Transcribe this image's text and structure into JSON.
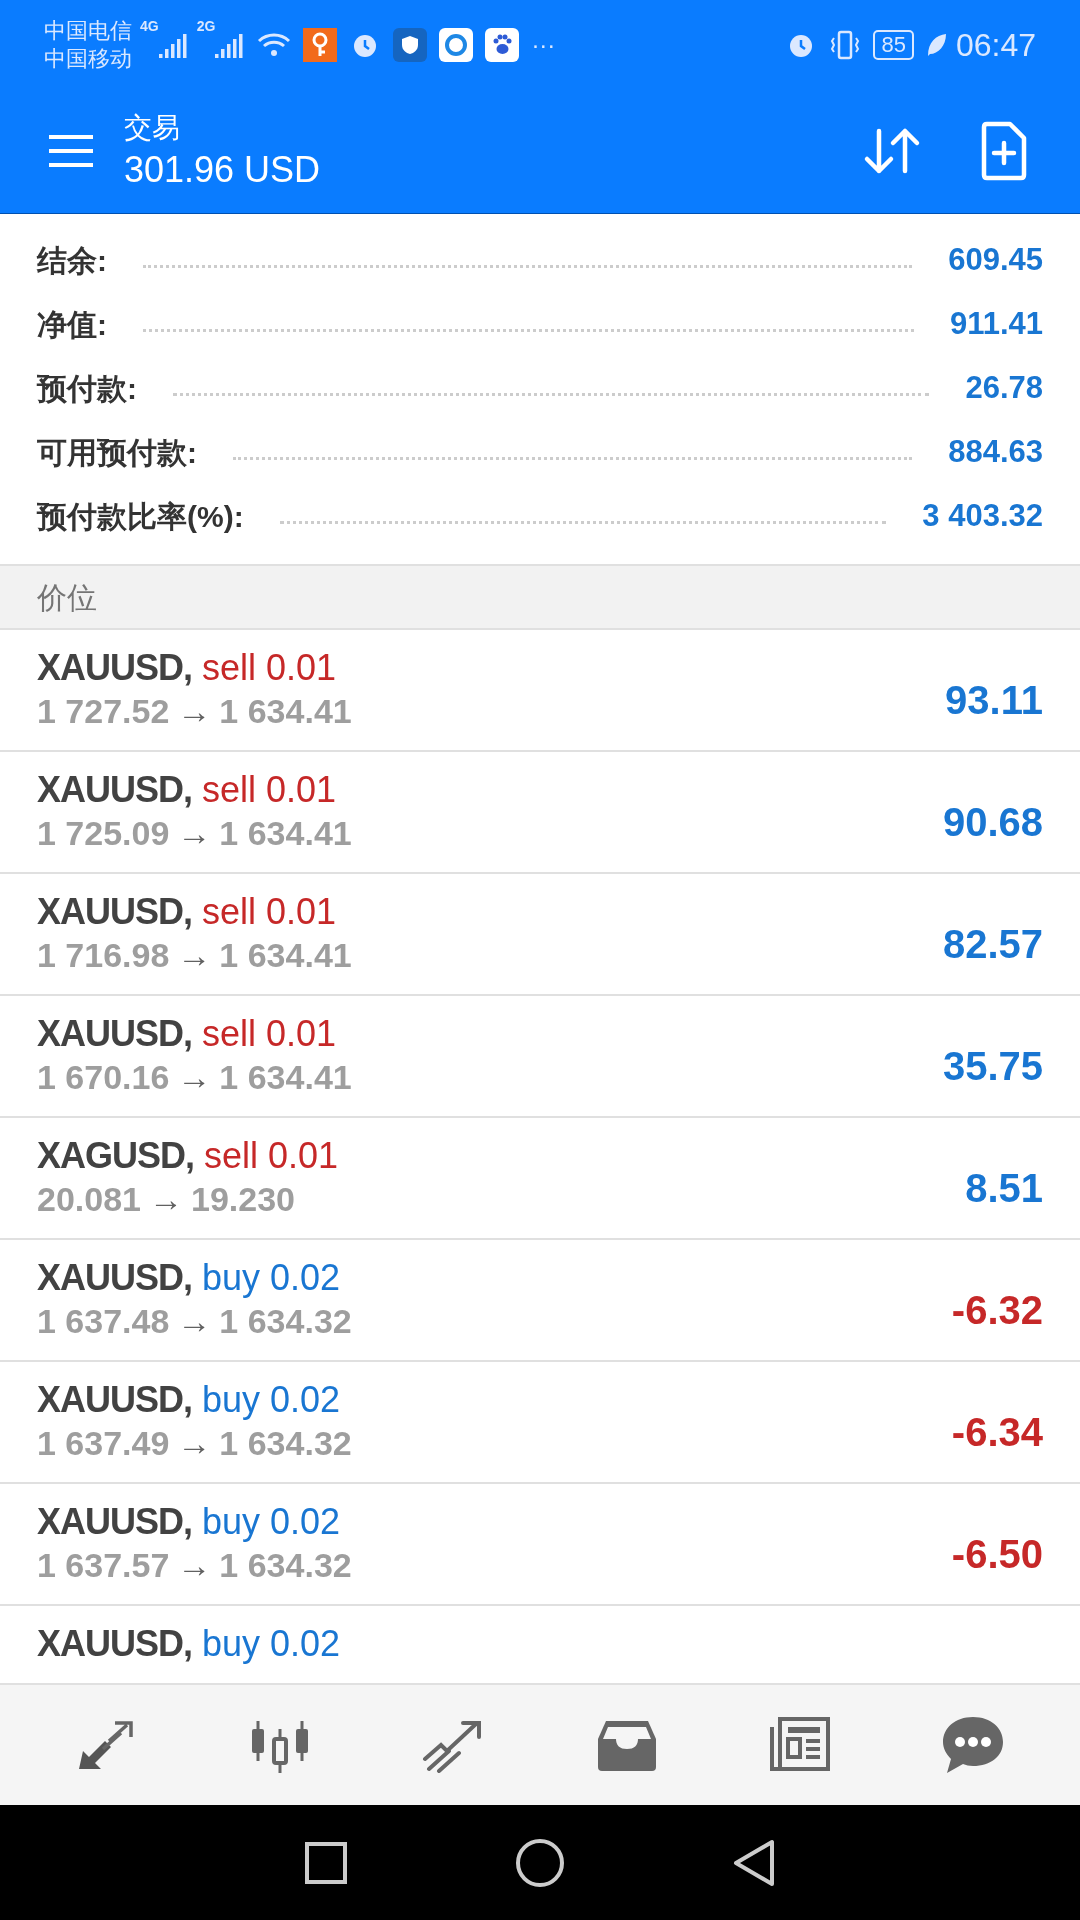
{
  "status_bar": {
    "carrier_1": "中国电信",
    "carrier_2": "中国移动",
    "network_1": "4G",
    "network_2": "2G",
    "more": "···",
    "battery": "85",
    "time": "06:47"
  },
  "app_bar": {
    "title": "交易",
    "subtitle": "301.96 USD"
  },
  "summary": [
    {
      "label": "结余:",
      "value": "609.45"
    },
    {
      "label": "净值:",
      "value": "911.41"
    },
    {
      "label": "预付款:",
      "value": "26.78"
    },
    {
      "label": "可用预付款:",
      "value": "884.63"
    },
    {
      "label": "预付款比率(%):",
      "value": "3 403.32"
    }
  ],
  "section_header": "价位",
  "positions": [
    {
      "symbol": "XAUUSD,",
      "kind": "sell",
      "order": "sell 0.01",
      "open": "1 727.52",
      "arrow": "→",
      "current": "1 634.41",
      "profit": "93.11",
      "loss": false
    },
    {
      "symbol": "XAUUSD,",
      "kind": "sell",
      "order": "sell 0.01",
      "open": "1 725.09",
      "arrow": "→",
      "current": "1 634.41",
      "profit": "90.68",
      "loss": false
    },
    {
      "symbol": "XAUUSD,",
      "kind": "sell",
      "order": "sell 0.01",
      "open": "1 716.98",
      "arrow": "→",
      "current": "1 634.41",
      "profit": "82.57",
      "loss": false
    },
    {
      "symbol": "XAUUSD,",
      "kind": "sell",
      "order": "sell 0.01",
      "open": "1 670.16",
      "arrow": "→",
      "current": "1 634.41",
      "profit": "35.75",
      "loss": false
    },
    {
      "symbol": "XAGUSD,",
      "kind": "sell",
      "order": "sell 0.01",
      "open": "20.081",
      "arrow": "→",
      "current": "19.230",
      "profit": "8.51",
      "loss": false
    },
    {
      "symbol": "XAUUSD,",
      "kind": "buy",
      "order": "buy 0.02",
      "open": "1 637.48",
      "arrow": "→",
      "current": "1 634.32",
      "profit": "-6.32",
      "loss": true
    },
    {
      "symbol": "XAUUSD,",
      "kind": "buy",
      "order": "buy 0.02",
      "open": "1 637.49",
      "arrow": "→",
      "current": "1 634.32",
      "profit": "-6.34",
      "loss": true
    },
    {
      "symbol": "XAUUSD,",
      "kind": "buy",
      "order": "buy 0.02",
      "open": "1 637.57",
      "arrow": "→",
      "current": "1 634.32",
      "profit": "-6.50",
      "loss": true
    },
    {
      "symbol": "XAUUSD,",
      "kind": "buy",
      "order": "buy 0.02"
    }
  ]
}
